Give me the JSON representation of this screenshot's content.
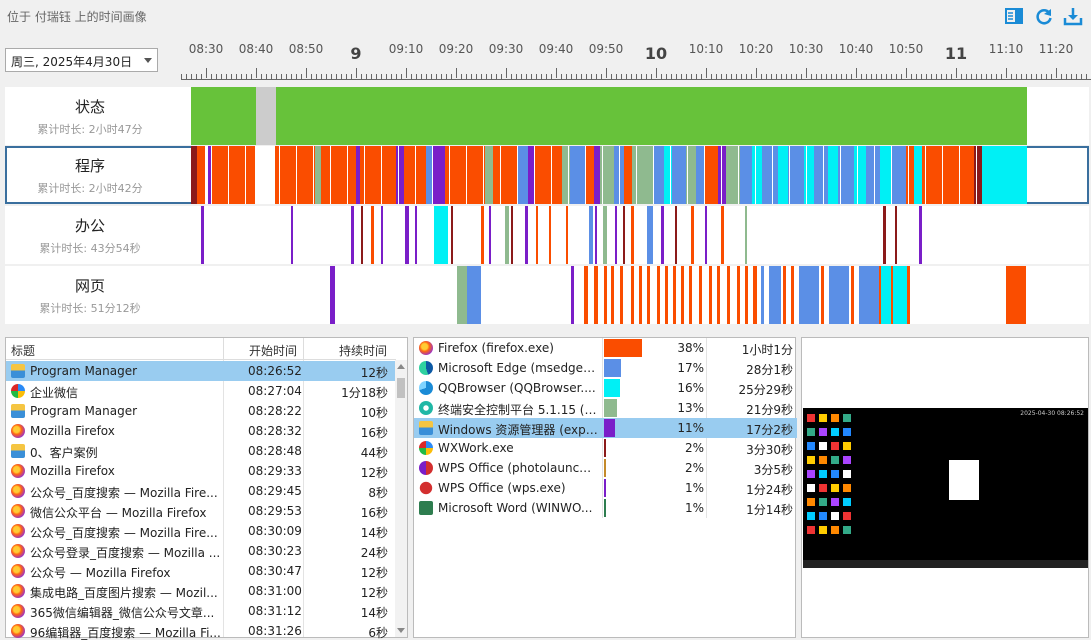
{
  "header": {
    "breadcrumb": "位于 付瑞钰 上的时间画像",
    "icons": [
      "sidebar-panel-icon",
      "refresh-icon",
      "download-icon"
    ],
    "accent": "#1a8bd6"
  },
  "date_select": {
    "value": "周三, 2025年4月30日"
  },
  "ruler": {
    "labels": [
      "08:30",
      "08:40",
      "08:50",
      "9",
      "09:10",
      "09:20",
      "09:30",
      "09:40",
      "09:50",
      "10",
      "10:10",
      "10:20",
      "10:30",
      "10:40",
      "10:50",
      "11",
      "11:10",
      "11:20"
    ]
  },
  "rows": [
    {
      "title": "状态",
      "sub": "累计时长: 2小时47分"
    },
    {
      "title": "程序",
      "sub": "累计时长: 2小时42分"
    },
    {
      "title": "办公",
      "sub": "累计时长: 43分54秒"
    },
    {
      "title": "网页",
      "sub": "累计时长: 51分12秒"
    }
  ],
  "colors": {
    "active": "#67c23a",
    "idle": "#cccccc",
    "firefox": "#fa4d00",
    "edge": "#5b8fe6",
    "qq": "#00f0f5",
    "ctrl": "#8fba8f",
    "explorer": "#7a1ec8",
    "wx": "#8b1a1a",
    "wps": "#c48a2a",
    "wpsw": "#7a1ec8",
    "word": "#2e7d4f"
  },
  "log": {
    "headers": {
      "title": "标题",
      "start": "开始时间",
      "dur": "持续时间"
    },
    "rows": [
      {
        "icon": "folder-icon",
        "title": "Program Manager",
        "start": "08:26:52",
        "dur": "12秒",
        "selected": true
      },
      {
        "icon": "wxwork-icon",
        "title": "企业微信",
        "start": "08:27:04",
        "dur": "1分18秒"
      },
      {
        "icon": "folder-icon",
        "title": "Program Manager",
        "start": "08:28:22",
        "dur": "10秒"
      },
      {
        "icon": "firefox-icon",
        "title": "Mozilla Firefox",
        "start": "08:28:32",
        "dur": "16秒"
      },
      {
        "icon": "folder-icon",
        "title": "0、客户案例",
        "start": "08:28:48",
        "dur": "44秒"
      },
      {
        "icon": "firefox-icon",
        "title": "Mozilla Firefox",
        "start": "08:29:33",
        "dur": "12秒"
      },
      {
        "icon": "firefox-icon",
        "title": "公众号_百度搜索 — Mozilla Fire...",
        "start": "08:29:45",
        "dur": "8秒"
      },
      {
        "icon": "firefox-icon",
        "title": "微信公众平台 — Mozilla Firefox",
        "start": "08:29:53",
        "dur": "16秒"
      },
      {
        "icon": "firefox-icon",
        "title": "公众号_百度搜索 — Mozilla Fire...",
        "start": "08:30:09",
        "dur": "14秒"
      },
      {
        "icon": "firefox-icon",
        "title": "公众号登录_百度搜索 — Mozilla ...",
        "start": "08:30:23",
        "dur": "24秒"
      },
      {
        "icon": "firefox-icon",
        "title": "公众号 — Mozilla Firefox",
        "start": "08:30:47",
        "dur": "12秒"
      },
      {
        "icon": "firefox-icon",
        "title": "集成电路_百度图片搜索 — Mozil...",
        "start": "08:31:00",
        "dur": "12秒"
      },
      {
        "icon": "firefox-icon",
        "title": "365微信编辑器_微信公众号文章...",
        "start": "08:31:12",
        "dur": "14秒"
      },
      {
        "icon": "firefox-icon",
        "title": "96编辑器_百度搜索 — Mozilla Fi...",
        "start": "08:31:26",
        "dur": "6秒"
      }
    ]
  },
  "apps": [
    {
      "icon": "firefox-icon",
      "name": "Firefox (firefox.exe)",
      "pct": "38%",
      "time": "1小时1分",
      "share": 0.38,
      "color": "#fa4d00"
    },
    {
      "icon": "edge-icon",
      "name": "Microsoft Edge (msedge....",
      "pct": "17%",
      "time": "28分1秒",
      "share": 0.17,
      "color": "#5b8fe6"
    },
    {
      "icon": "qqbrowser-icon",
      "name": "QQBrowser (QQBrowser....",
      "pct": "16%",
      "time": "25分29秒",
      "share": 0.16,
      "color": "#00f0f5"
    },
    {
      "icon": "security-icon",
      "name": "终端安全控制平台 5.1.15 (p...",
      "pct": "13%",
      "time": "21分9秒",
      "share": 0.13,
      "color": "#8fba8f"
    },
    {
      "icon": "folder-icon",
      "name": "Windows 资源管理器 (expl...",
      "pct": "11%",
      "time": "17分2秒",
      "share": 0.11,
      "color": "#7a1ec8",
      "selected": true
    },
    {
      "icon": "wxwork-icon",
      "name": "WXWork.exe",
      "pct": "2%",
      "time": "3分30秒",
      "share": 0.02,
      "color": "#8b1a1a"
    },
    {
      "icon": "wps-icon",
      "name": "WPS Office (photolaunch....",
      "pct": "2%",
      "time": "3分5秒",
      "share": 0.02,
      "color": "#c48a2a"
    },
    {
      "icon": "wps-w-icon",
      "name": "WPS Office (wps.exe)",
      "pct": "1%",
      "time": "1分24秒",
      "share": 0.01,
      "color": "#7a1ec8"
    },
    {
      "icon": "word-icon",
      "name": "Microsoft Word (WINWO...",
      "pct": "1%",
      "time": "1分14秒",
      "share": 0.01,
      "color": "#2e7d4f"
    }
  ],
  "preview": {
    "clock": "2025-04-30 08:26:52"
  }
}
